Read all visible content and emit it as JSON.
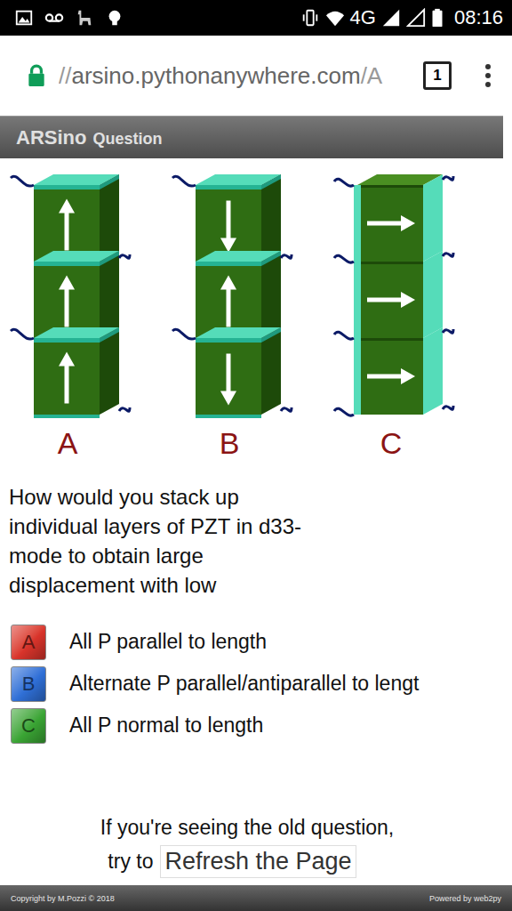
{
  "status_bar": {
    "network": "4G",
    "time": "08:16"
  },
  "browser": {
    "scheme": "//",
    "host": "arsino.pythonanywhere.com",
    "path": "/A",
    "tab_count": "1"
  },
  "header": {
    "brand": "ARSino",
    "title": "Question"
  },
  "figure": {
    "stacks": [
      {
        "label": "A",
        "kind": "layered",
        "arrows": [
          "up",
          "up",
          "up"
        ]
      },
      {
        "label": "B",
        "kind": "layered",
        "arrows": [
          "down",
          "up",
          "down"
        ]
      },
      {
        "label": "C",
        "kind": "sided",
        "arrows": [
          "right",
          "right",
          "right"
        ]
      }
    ]
  },
  "question": "How would you stack up individual layers of PZT in d33-mode to obtain large displacement with low",
  "options": [
    {
      "letter": "A",
      "text": "All P parallel to length",
      "color": "#d9342b"
    },
    {
      "letter": "B",
      "text": "Alternate P parallel/antiparallel to lengt",
      "color": "#2f6fd6"
    },
    {
      "letter": "C",
      "text": "All P normal to length",
      "color": "#3aa534"
    }
  ],
  "refresh": {
    "prompt": "If you're seeing the old question,",
    "lead": "try to",
    "button": "Refresh the Page"
  },
  "footer": {
    "copyright": "Copyright by M.Pozzi © 2018",
    "powered": "Powered by web2py"
  }
}
